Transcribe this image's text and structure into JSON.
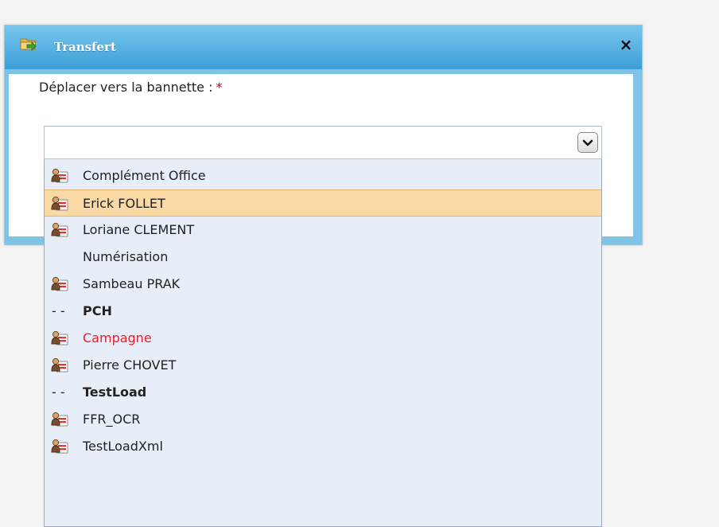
{
  "dialog": {
    "title": "Transfert",
    "close_label": "×",
    "field_label": "Déplacer vers la bannette :",
    "required_marker": "*",
    "select_value": ""
  },
  "dropdown": {
    "items": [
      {
        "label": "Complément Office",
        "type": "user",
        "selected": false
      },
      {
        "label": "Erick FOLLET",
        "type": "user",
        "selected": true
      },
      {
        "label": "Loriane CLEMENT",
        "type": "user",
        "selected": false
      },
      {
        "label": "Numérisation",
        "type": "plain",
        "selected": false
      },
      {
        "label": "Sambeau PRAK",
        "type": "user",
        "selected": false
      },
      {
        "prefix": "- -",
        "label": "PCH",
        "type": "group",
        "selected": false
      },
      {
        "label": "Campagne",
        "type": "user",
        "selected": false,
        "color": "#e0202a"
      },
      {
        "label": "Pierre CHOVET",
        "type": "user",
        "selected": false
      },
      {
        "prefix": "- -",
        "label": "TestLoad",
        "type": "group",
        "selected": false
      },
      {
        "label": "FFR_OCR",
        "type": "user",
        "selected": false
      },
      {
        "label": "TestLoadXml",
        "type": "user",
        "selected": false
      }
    ]
  },
  "icons": {
    "title": "folder-transfer-icon",
    "item": "user-card-icon",
    "select_button": "chevron-down-icon"
  },
  "colors": {
    "titlebar": "#3c9fd6",
    "selected_row": "#fbd9a4",
    "dropdown_bg": "#e8eef7",
    "required": "#e00000"
  }
}
